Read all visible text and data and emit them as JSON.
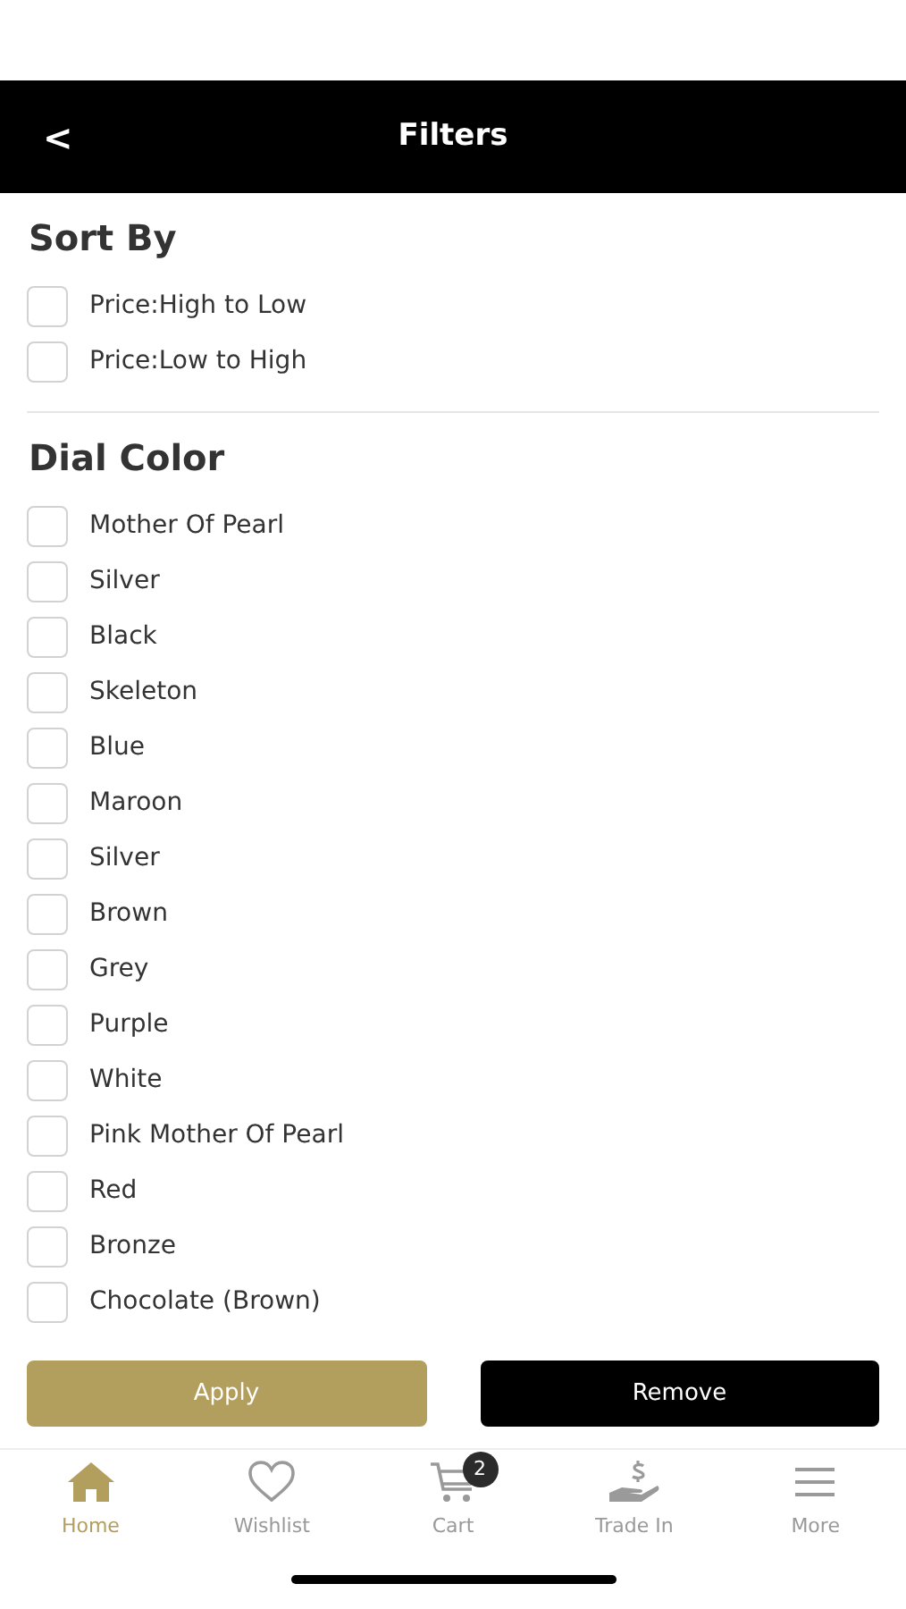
{
  "header": {
    "back_icon": "<",
    "title": "Filters"
  },
  "sections": [
    {
      "title": "Sort By",
      "options": [
        {
          "label": "Price:High to Low",
          "checked": false
        },
        {
          "label": "Price:Low to High",
          "checked": false
        }
      ]
    },
    {
      "title": "Dial Color",
      "options": [
        {
          "label": "Mother Of Pearl",
          "checked": false
        },
        {
          "label": "Silver",
          "checked": false
        },
        {
          "label": "Black",
          "checked": false
        },
        {
          "label": "Skeleton",
          "checked": false
        },
        {
          "label": "Blue",
          "checked": false
        },
        {
          "label": "Maroon",
          "checked": false
        },
        {
          "label": "Silver",
          "checked": false
        },
        {
          "label": "Brown",
          "checked": false
        },
        {
          "label": "Grey",
          "checked": false
        },
        {
          "label": "Purple",
          "checked": false
        },
        {
          "label": "White",
          "checked": false
        },
        {
          "label": "Pink Mother Of Pearl",
          "checked": false
        },
        {
          "label": "Red",
          "checked": false
        },
        {
          "label": "Bronze",
          "checked": false
        },
        {
          "label": "Chocolate (Brown)",
          "checked": false
        }
      ]
    }
  ],
  "buttons": [
    {
      "label": "Apply",
      "kind": "primary"
    },
    {
      "label": "Remove",
      "kind": "dark"
    }
  ],
  "bottom_nav": [
    {
      "label": "Home",
      "kind": "home",
      "selected": true
    },
    {
      "label": "Wishlist",
      "kind": "heart",
      "selected": false
    },
    {
      "label": "Cart",
      "kind": "cart",
      "selected": false,
      "badge": "2"
    },
    {
      "label": "Trade In",
      "kind": "trade",
      "selected": false
    },
    {
      "label": "More",
      "kind": "menu",
      "selected": false
    }
  ]
}
